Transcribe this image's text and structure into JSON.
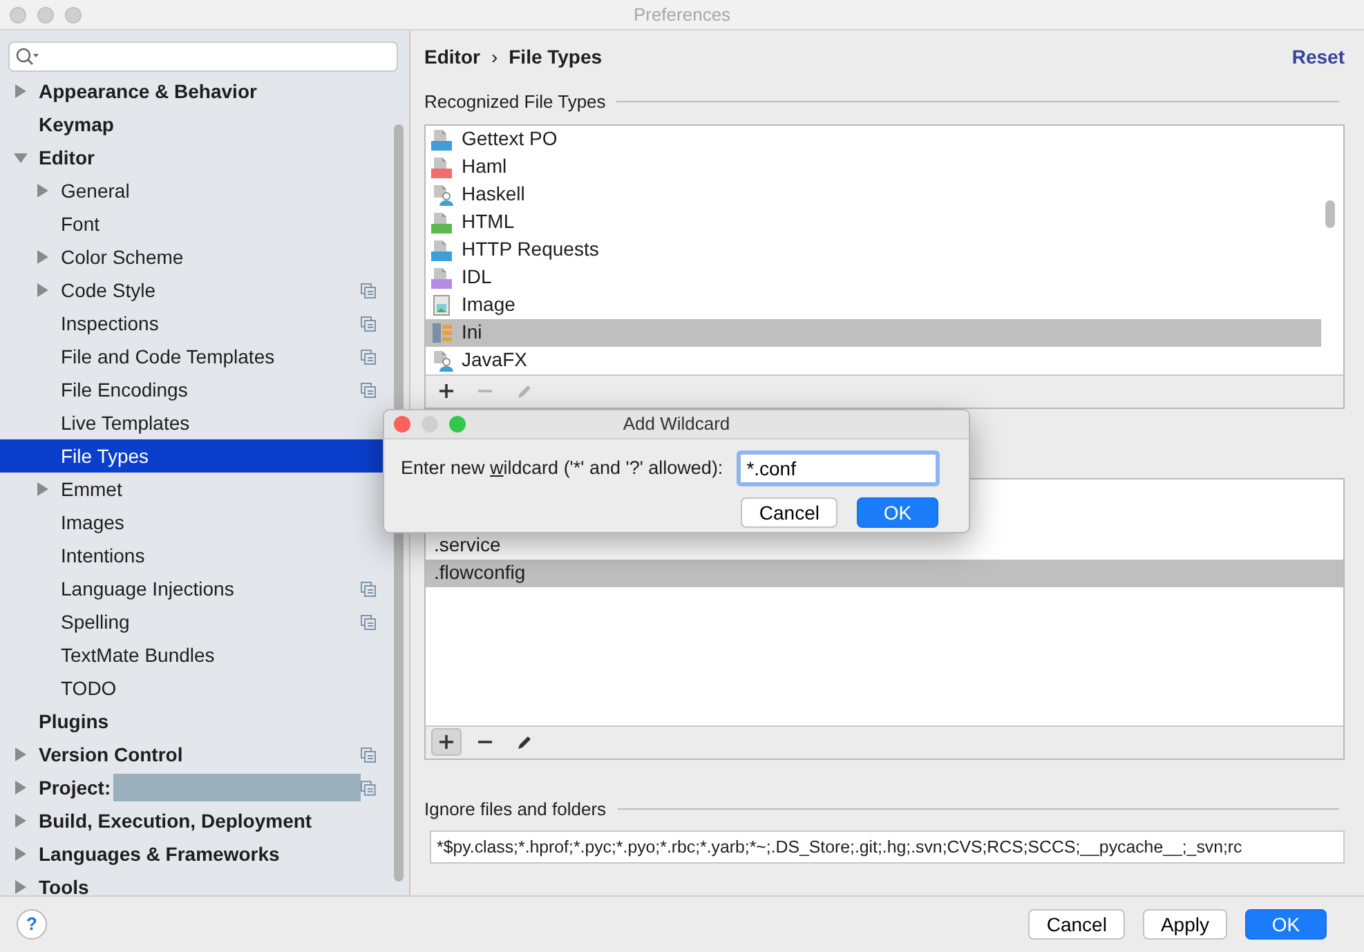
{
  "window": {
    "title": "Preferences"
  },
  "sidebar": {
    "items": [
      {
        "label": "Appearance & Behavior",
        "kind": "branch",
        "expanded": false,
        "selected": false,
        "shared": false
      },
      {
        "label": "Keymap",
        "kind": "leaf",
        "selected": false,
        "shared": false
      },
      {
        "label": "Editor",
        "kind": "branch",
        "expanded": true,
        "selected": false,
        "shared": false,
        "children": [
          {
            "label": "General",
            "kind": "branch",
            "expanded": false,
            "selected": false,
            "shared": false
          },
          {
            "label": "Font",
            "kind": "leaf",
            "selected": false,
            "shared": false
          },
          {
            "label": "Color Scheme",
            "kind": "branch",
            "expanded": false,
            "selected": false,
            "shared": false
          },
          {
            "label": "Code Style",
            "kind": "branch",
            "expanded": false,
            "selected": false,
            "shared": true
          },
          {
            "label": "Inspections",
            "kind": "leaf",
            "selected": false,
            "shared": true
          },
          {
            "label": "File and Code Templates",
            "kind": "leaf",
            "selected": false,
            "shared": true
          },
          {
            "label": "File Encodings",
            "kind": "leaf",
            "selected": false,
            "shared": true
          },
          {
            "label": "Live Templates",
            "kind": "leaf",
            "selected": false,
            "shared": false
          },
          {
            "label": "File Types",
            "kind": "leaf",
            "selected": true,
            "shared": false
          },
          {
            "label": "Emmet",
            "kind": "branch",
            "expanded": false,
            "selected": false,
            "shared": false
          },
          {
            "label": "Images",
            "kind": "leaf",
            "selected": false,
            "shared": false
          },
          {
            "label": "Intentions",
            "kind": "leaf",
            "selected": false,
            "shared": false
          },
          {
            "label": "Language Injections",
            "kind": "leaf",
            "selected": false,
            "shared": true
          },
          {
            "label": "Spelling",
            "kind": "leaf",
            "selected": false,
            "shared": true
          },
          {
            "label": "TextMate Bundles",
            "kind": "leaf",
            "selected": false,
            "shared": false
          },
          {
            "label": "TODO",
            "kind": "leaf",
            "selected": false,
            "shared": false
          }
        ]
      },
      {
        "label": "Plugins",
        "kind": "leaf",
        "selected": false,
        "shared": false
      },
      {
        "label": "Version Control",
        "kind": "branch",
        "expanded": false,
        "selected": false,
        "shared": true
      },
      {
        "label": "Project:",
        "kind": "branch",
        "expanded": false,
        "selected": false,
        "shared": true,
        "redacted": true
      },
      {
        "label": "Build, Execution, Deployment",
        "kind": "branch",
        "expanded": false,
        "selected": false,
        "shared": false
      },
      {
        "label": "Languages & Frameworks",
        "kind": "branch",
        "expanded": false,
        "selected": false,
        "shared": false
      },
      {
        "label": "Tools",
        "kind": "branch",
        "expanded": false,
        "selected": false,
        "shared": false
      }
    ]
  },
  "header": {
    "breadcrumb": [
      "Editor",
      "File Types"
    ],
    "separator": "›",
    "reset": "Reset"
  },
  "file_types": {
    "title": "Recognized File Types",
    "rows": [
      {
        "name": "Gettext PO",
        "kind": "badge",
        "color": "#3d9fd6",
        "selected": false
      },
      {
        "name": "Haml",
        "kind": "badge",
        "color": "#f26d6d",
        "selected": false
      },
      {
        "name": "Haskell",
        "kind": "person",
        "selected": false
      },
      {
        "name": "HTML",
        "kind": "badge",
        "color": "#5fb84f",
        "selected": false
      },
      {
        "name": "HTTP Requests",
        "kind": "badge",
        "color": "#3d9fd6",
        "selected": false
      },
      {
        "name": "IDL",
        "kind": "badge",
        "color": "#b48ce6",
        "selected": false
      },
      {
        "name": "Image",
        "kind": "image",
        "selected": false
      },
      {
        "name": "Ini",
        "kind": "ini",
        "selected": true
      },
      {
        "name": "JavaFX",
        "kind": "person",
        "selected": false
      }
    ],
    "toolbar": [
      {
        "kind": "add",
        "disabled": false
      },
      {
        "kind": "remove",
        "disabled": true
      },
      {
        "kind": "edit",
        "disabled": true
      }
    ]
  },
  "patterns": {
    "rows": [
      {
        "text": ".service",
        "selected": false
      },
      {
        "text": ".flowconfig",
        "selected": true
      }
    ],
    "toolbar": [
      {
        "kind": "add",
        "disabled": false
      },
      {
        "kind": "remove",
        "disabled": false
      },
      {
        "kind": "edit",
        "disabled": false
      }
    ]
  },
  "ignore": {
    "title": "Ignore files and folders",
    "value": "*$py.class;*.hprof;*.pyc;*.pyo;*.rbc;*.yarb;*~;.DS_Store;.git;.hg;.svn;CVS;RCS;SCCS;__pycache__;_svn;rc"
  },
  "footer": {
    "help": "?",
    "buttons": [
      {
        "label": "Cancel",
        "kind": "default"
      },
      {
        "label": "Apply",
        "kind": "default"
      },
      {
        "label": "OK",
        "kind": "primary"
      }
    ]
  },
  "dialog": {
    "title": "Add Wildcard",
    "label_before": "Enter new ",
    "mnemonic": "w",
    "label_after": "ildcard ('*' and '?' allowed):",
    "value": "*.conf",
    "buttons": [
      {
        "label": "Cancel",
        "kind": "default"
      },
      {
        "label": "OK",
        "kind": "primary"
      }
    ]
  }
}
